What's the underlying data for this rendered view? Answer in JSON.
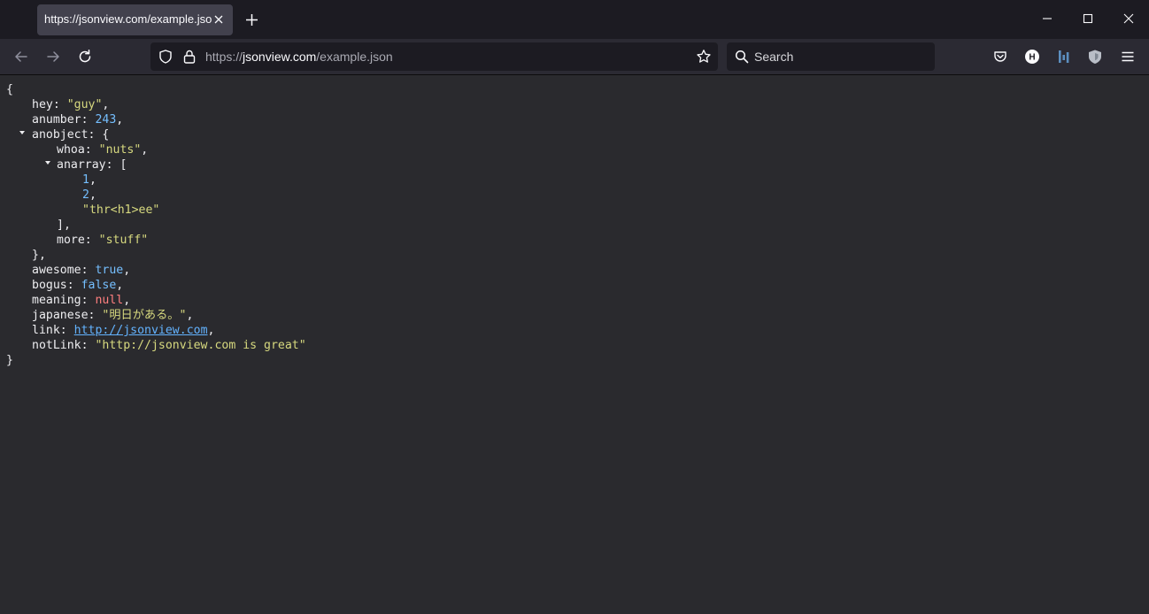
{
  "tab": {
    "title": "https://jsonview.com/example.json"
  },
  "url": {
    "scheme": "https://",
    "host": "jsonview.com",
    "path": "/example.json"
  },
  "search": {
    "placeholder": "Search"
  },
  "json": {
    "open_brace": "{",
    "close_brace": "}",
    "hey": {
      "key": "hey",
      "value": "\"guy\""
    },
    "anumber": {
      "key": "anumber",
      "value": "243"
    },
    "anobject": {
      "key": "anobject",
      "open": "{",
      "close": "},"
    },
    "whoa": {
      "key": "whoa",
      "value": "\"nuts\""
    },
    "anarray": {
      "key": "anarray",
      "open": "[",
      "close": "],",
      "items": [
        "1",
        "2",
        "\"thr<h1>ee\""
      ]
    },
    "more": {
      "key": "more",
      "value": "\"stuff\""
    },
    "awesome": {
      "key": "awesome",
      "value": "true"
    },
    "bogus": {
      "key": "bogus",
      "value": "false"
    },
    "meaning": {
      "key": "meaning",
      "value": "null"
    },
    "japanese": {
      "key": "japanese",
      "value": "\"明日がある。\""
    },
    "link": {
      "key": "link",
      "value": "http://jsonview.com"
    },
    "notLink": {
      "key": "notLink",
      "value": "\"http://jsonview.com is great\""
    }
  },
  "colors": {
    "string": "#d7d97f",
    "number": "#75bfff",
    "null": "#ff7f7f",
    "link": "#63b3ff",
    "background": "#2a2a2e"
  },
  "icons": [
    "back-arrow-icon",
    "forward-arrow-icon",
    "reload-icon",
    "shield-icon",
    "lock-icon",
    "star-icon",
    "search-icon",
    "pocket-icon",
    "h-extension-icon",
    "stats-extension-icon",
    "shield-extension-icon",
    "hamburger-menu-icon",
    "close-icon",
    "plus-icon",
    "minimize-icon",
    "maximize-icon"
  ]
}
